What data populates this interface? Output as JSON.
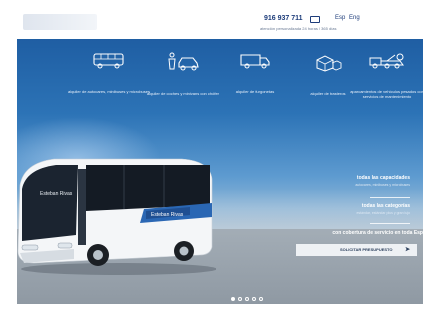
{
  "header": {
    "phone": "916 937 711",
    "languages": [
      "Esp",
      "Eng"
    ],
    "attention": "atención personalizada 24 horas / 365 días"
  },
  "services": [
    {
      "icon": "minibus-icon",
      "label": "alquiler de autocares, minibuses y microbuses"
    },
    {
      "icon": "car-driver-icon",
      "label": "alquiler de coches y minivans con chófer"
    },
    {
      "icon": "van-icon",
      "label": "alquiler de furgonetas"
    },
    {
      "icon": "boxes-icon",
      "label": "alquiler de trasteros"
    },
    {
      "icon": "tow-truck-icon",
      "label": "aparcamientos de vehículos pesados con servicios de mantenimiento"
    }
  ],
  "hero": {
    "line1": "todas las capacidades",
    "line1_sub": "autocares, minibuses y microbuses",
    "line2": "todas las categorías",
    "line2_sub": "estándar, estándar plus y gran lujo",
    "line3": "con cobertura de servicio en toda Esp",
    "quote_button": "SOLICITAR PRESUPUESTO",
    "bus_brand": "Esteban Rivas",
    "slides": 5,
    "active_slide": 1
  },
  "colors": {
    "brand_blue": "#1d3c7a",
    "hero_blue": "#2c73b6"
  }
}
